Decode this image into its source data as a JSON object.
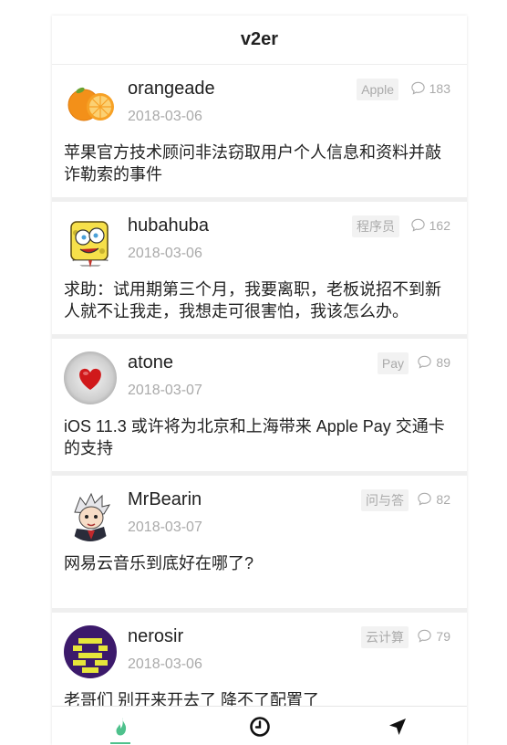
{
  "app": {
    "title": "v2er"
  },
  "topics": [
    {
      "username": "orangeade",
      "date": "2018-03-06",
      "node": "Apple",
      "comments": "183",
      "title": "苹果官方技术顾问非法窃取用户个人信息和资料并敲诈勒索的事件",
      "avatar_icon": "orange-avatar"
    },
    {
      "username": "hubahuba",
      "date": "2018-03-06",
      "node": "程序员",
      "comments": "162",
      "title": "求助：试用期第三个月，我要离职，老板说招不到新人就不让我走，我想走可很害怕，我该怎么办。",
      "avatar_icon": "cartoon-avatar"
    },
    {
      "username": "atone",
      "date": "2018-03-07",
      "node": " Pay",
      "comments": "89",
      "title": "iOS 11.3 或许将为北京和上海带来 Apple Pay 交通卡的支持",
      "avatar_icon": "heart-avatar"
    },
    {
      "username": "MrBearin",
      "date": "2018-03-07",
      "node": "问与答",
      "comments": "82",
      "title": "网易云音乐到底好在哪了?",
      "avatar_icon": "anime-avatar"
    },
    {
      "username": "nerosir",
      "date": "2018-03-06",
      "node": "云计算",
      "comments": "79",
      "title": "老哥们 别开来开去了 降不了配置了",
      "avatar_icon": "pixel-avatar"
    }
  ],
  "tabbar": {
    "items": [
      {
        "icon": "flame-icon",
        "active": true
      },
      {
        "icon": "clock-icon",
        "active": false
      },
      {
        "icon": "navigation-arrow-icon",
        "active": false
      }
    ]
  },
  "colors": {
    "accent": "#4ec18c",
    "meta_gray": "#aaaaaa",
    "tag_bg": "#f2f2f2",
    "background": "#efefef"
  }
}
